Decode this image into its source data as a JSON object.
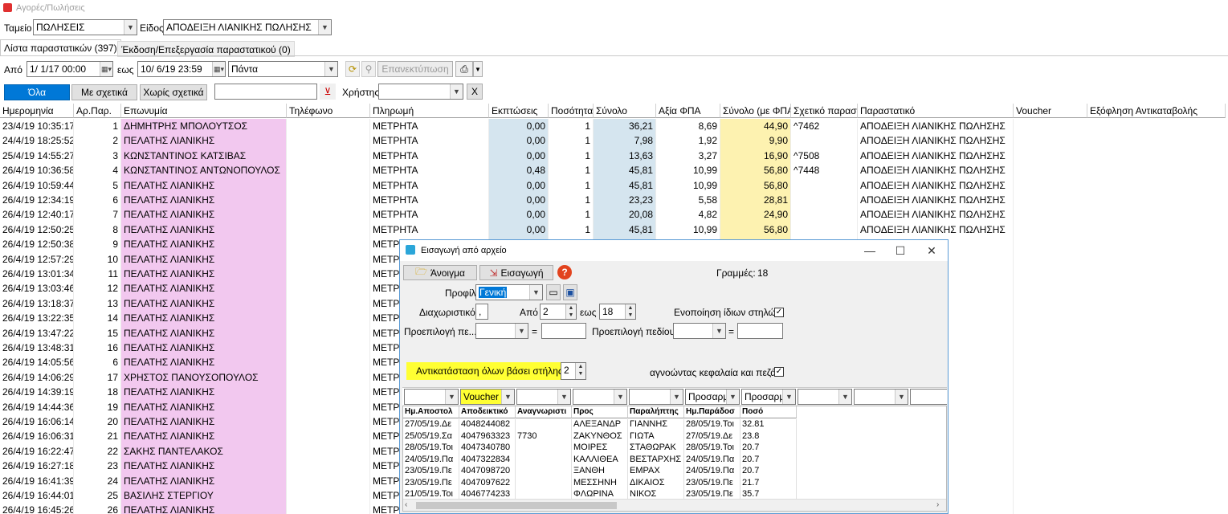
{
  "window": {
    "title": "Αγορές/Πωλήσεις"
  },
  "filters": {
    "tameio_label": "Ταμείο",
    "tameio_value": "ΠΩΛΗΣΕΙΣ",
    "eidos_label": "Είδος",
    "eidos_value": "ΑΠΟΔΕΙΞΗ ΛΙΑΝΙΚΗΣ ΠΩΛΗΣΗΣ",
    "apo_label": "Από",
    "apo_value": "1/ 1/17 00:00",
    "eos_label": "εως",
    "eos_value": "10/ 6/19 23:59",
    "period_value": "Πάντα",
    "reprint_label": "Επανεκτύπωση",
    "xristis_label": "Χρήστης",
    "clear_label": "X"
  },
  "tabs": [
    "Λίστα παραστατικών (397)",
    "Έκδοση/Επεξεργασία παραστατικού (0)"
  ],
  "segment": [
    "Όλα",
    "Με σχετικά",
    "Χωρίς σχετικά"
  ],
  "grid": {
    "headers": [
      "Ημερομηνία",
      "Αρ.Παρ.",
      "Επωνυμία",
      "Τηλέφωνο",
      "Πληρωμή",
      "Εκπτώσεις",
      "Ποσότητα",
      "Σύνολο",
      "Αξία ΦΠΑ",
      "Σύνολο (με ΦΠΑ)",
      "Σχετικό παραστ",
      "Παραστατικό",
      "Voucher",
      "Εξόφληση Αντικαταβολής"
    ],
    "rows": [
      [
        "23/4/19 10:35:17",
        "1",
        "ΔΗΜΗΤΡΗΣ ΜΠΟΛΟΥΤΣΟΣ",
        "",
        "ΜΕΤΡΗΤΑ",
        "0,00",
        "1",
        "36,21",
        "8,69",
        "44,90",
        "^7462",
        "ΑΠΟΔΕΙΞΗ ΛΙΑΝΙΚΗΣ ΠΩΛΗΣΗΣ"
      ],
      [
        "24/4/19 18:25:52",
        "2",
        "ΠΕΛΑΤΗΣ ΛΙΑΝΙΚΗΣ",
        "",
        "ΜΕΤΡΗΤΑ",
        "0,00",
        "1",
        "7,98",
        "1,92",
        "9,90",
        "",
        "ΑΠΟΔΕΙΞΗ ΛΙΑΝΙΚΗΣ ΠΩΛΗΣΗΣ"
      ],
      [
        "25/4/19 14:55:27",
        "3",
        "ΚΩΝΣΤΑΝΤΙΝΟΣ ΚΑΤΣΙΒΑΣ",
        "",
        "ΜΕΤΡΗΤΑ",
        "0,00",
        "1",
        "13,63",
        "3,27",
        "16,90",
        "^7508",
        "ΑΠΟΔΕΙΞΗ ΛΙΑΝΙΚΗΣ ΠΩΛΗΣΗΣ"
      ],
      [
        "26/4/19 10:36:58",
        "4",
        "ΚΩΝΣΤΑΝΤΙΝΟΣ ΑΝΤΩΝΟΠΟΥΛΟΣ",
        "",
        "ΜΕΤΡΗΤΑ",
        "0,48",
        "1",
        "45,81",
        "10,99",
        "56,80",
        "^7448",
        "ΑΠΟΔΕΙΞΗ ΛΙΑΝΙΚΗΣ ΠΩΛΗΣΗΣ"
      ],
      [
        "26/4/19 10:59:44",
        "5",
        "ΠΕΛΑΤΗΣ ΛΙΑΝΙΚΗΣ",
        "",
        "ΜΕΤΡΗΤΑ",
        "0,00",
        "1",
        "45,81",
        "10,99",
        "56,80",
        "",
        "ΑΠΟΔΕΙΞΗ ΛΙΑΝΙΚΗΣ ΠΩΛΗΣΗΣ"
      ],
      [
        "26/4/19 12:34:19",
        "6",
        "ΠΕΛΑΤΗΣ ΛΙΑΝΙΚΗΣ",
        "",
        "ΜΕΤΡΗΤΑ",
        "0,00",
        "1",
        "23,23",
        "5,58",
        "28,81",
        "",
        "ΑΠΟΔΕΙΞΗ ΛΙΑΝΙΚΗΣ ΠΩΛΗΣΗΣ"
      ],
      [
        "26/4/19 12:40:17",
        "7",
        "ΠΕΛΑΤΗΣ ΛΙΑΝΙΚΗΣ",
        "",
        "ΜΕΤΡΗΤΑ",
        "0,00",
        "1",
        "20,08",
        "4,82",
        "24,90",
        "",
        "ΑΠΟΔΕΙΞΗ ΛΙΑΝΙΚΗΣ ΠΩΛΗΣΗΣ"
      ],
      [
        "26/4/19 12:50:25",
        "8",
        "ΠΕΛΑΤΗΣ ΛΙΑΝΙΚΗΣ",
        "",
        "ΜΕΤΡΗΤΑ",
        "0,00",
        "1",
        "45,81",
        "10,99",
        "56,80",
        "",
        "ΑΠΟΔΕΙΞΗ ΛΙΑΝΙΚΗΣ ΠΩΛΗΣΗΣ"
      ],
      [
        "26/4/19 12:50:38",
        "9",
        "ΠΕΛΑΤΗΣ ΛΙΑΝΙΚΗΣ",
        "",
        "ΜΕΤΡ",
        "",
        "",
        "",
        "",
        "",
        "",
        "Σ ΠΩΛΗΣΗΣ"
      ],
      [
        "26/4/19 12:57:29",
        "10",
        "ΠΕΛΑΤΗΣ ΛΙΑΝΙΚΗΣ",
        "",
        "ΜΕΤΡ",
        "",
        "",
        "",
        "",
        "",
        "",
        "Σ ΠΩΛΗΣΗΣ"
      ],
      [
        "26/4/19 13:01:34",
        "11",
        "ΠΕΛΑΤΗΣ ΛΙΑΝΙΚΗΣ",
        "",
        "ΜΕΤΡ",
        "",
        "",
        "",
        "",
        "",
        "",
        "Σ ΠΩΛΗΣΗΣ"
      ],
      [
        "26/4/19 13:03:46",
        "12",
        "ΠΕΛΑΤΗΣ ΛΙΑΝΙΚΗΣ",
        "",
        "ΜΕΤΡ",
        "",
        "",
        "",
        "",
        "",
        "",
        "Σ ΠΩΛΗΣΗΣ"
      ],
      [
        "26/4/19 13:18:37",
        "13",
        "ΠΕΛΑΤΗΣ ΛΙΑΝΙΚΗΣ",
        "",
        "ΜΕΤΡ",
        "",
        "",
        "",
        "",
        "",
        "",
        "Σ ΠΩΛΗΣΗΣ"
      ],
      [
        "26/4/19 13:22:35",
        "14",
        "ΠΕΛΑΤΗΣ ΛΙΑΝΙΚΗΣ",
        "",
        "ΜΕΤΡ",
        "",
        "",
        "",
        "",
        "",
        "",
        "Σ ΠΩΛΗΣΗΣ"
      ],
      [
        "26/4/19 13:47:22",
        "15",
        "ΠΕΛΑΤΗΣ ΛΙΑΝΙΚΗΣ",
        "",
        "ΜΕΤΡ",
        "",
        "",
        "",
        "",
        "",
        "",
        "Σ ΠΩΛΗΣΗΣ"
      ],
      [
        "26/4/19 13:48:31",
        "16",
        "ΠΕΛΑΤΗΣ ΛΙΑΝΙΚΗΣ",
        "",
        "ΜΕΤΡ",
        "",
        "",
        "",
        "",
        "",
        "",
        "Σ ΠΩΛΗΣΗΣ"
      ],
      [
        "26/4/19 14:05:56",
        "6",
        "ΠΕΛΑΤΗΣ ΛΙΑΝΙΚΗΣ",
        "",
        "ΜΕΤΡ",
        "",
        "",
        "",
        "",
        "",
        "",
        "Σ ΠΩΛΗΣΗΣ"
      ],
      [
        "26/4/19 14:06:29",
        "17",
        "ΧΡΗΣΤΟΣ ΠΑΝΟΥΣΟΠΟΥΛΟΣ",
        "",
        "ΜΕΤΡ",
        "",
        "",
        "",
        "",
        "",
        "",
        "Σ ΠΩΛΗΣΗΣ"
      ],
      [
        "26/4/19 14:39:19",
        "18",
        "ΠΕΛΑΤΗΣ ΛΙΑΝΙΚΗΣ",
        "",
        "ΜΕΤΡ",
        "",
        "",
        "",
        "",
        "",
        "",
        "Σ ΠΩΛΗΣΗΣ"
      ],
      [
        "26/4/19 14:44:36",
        "19",
        "ΠΕΛΑΤΗΣ ΛΙΑΝΙΚΗΣ",
        "",
        "ΜΕΤΡ",
        "",
        "",
        "",
        "",
        "",
        "",
        "Σ ΠΩΛΗΣΗΣ"
      ],
      [
        "26/4/19 16:06:14",
        "20",
        "ΠΕΛΑΤΗΣ ΛΙΑΝΙΚΗΣ",
        "",
        "ΜΕΤΡ",
        "",
        "",
        "",
        "",
        "",
        "",
        "Σ ΠΩΛΗΣΗΣ"
      ],
      [
        "26/4/19 16:06:31",
        "21",
        "ΠΕΛΑΤΗΣ ΛΙΑΝΙΚΗΣ",
        "",
        "ΜΕΤΡ",
        "",
        "",
        "",
        "",
        "",
        "",
        "Σ ΠΩΛΗΣΗΣ"
      ],
      [
        "26/4/19 16:22:47",
        "22",
        "ΣΑΚΗΣ ΠΑΝΤΕΛΑΚΟΣ",
        "",
        "ΜΕΤΡ",
        "",
        "",
        "",
        "",
        "",
        "",
        "Σ ΠΩΛΗΣΗΣ"
      ],
      [
        "26/4/19 16:27:18",
        "23",
        "ΠΕΛΑΤΗΣ ΛΙΑΝΙΚΗΣ",
        "",
        "ΜΕΤΡ",
        "",
        "",
        "",
        "",
        "",
        "",
        "Σ ΠΩΛΗΣΗΣ"
      ],
      [
        "26/4/19 16:41:39",
        "24",
        "ΠΕΛΑΤΗΣ ΛΙΑΝΙΚΗΣ",
        "",
        "ΜΕΤΡ",
        "",
        "",
        "",
        "",
        "",
        "",
        "Σ ΠΩΛΗΣΗΣ"
      ],
      [
        "26/4/19 16:44:01",
        "25",
        "ΒΑΣΙΛΗΣ ΣΤΕΡΓΙΟΥ",
        "",
        "ΜΕΤΡ",
        "",
        "",
        "",
        "",
        "",
        "",
        "Σ ΠΩΛΗΣΗΣ"
      ],
      [
        "26/4/19 16:45:26",
        "26",
        "ΠΕΛΑΤΗΣ ΛΙΑΝΙΚΗΣ",
        "",
        "ΜΕΤΡ",
        "",
        "",
        "",
        "",
        "",
        "",
        "Σ ΠΩΛΗΣΗΣ"
      ]
    ]
  },
  "dialog": {
    "title": "Εισαγωγή από αρχείο",
    "open_label": "Άνοιγμα",
    "import_label": "Εισαγωγή",
    "help_glyph": "?",
    "lines_label": "Γραμμές:",
    "lines_value": "18",
    "profile_label": "Προφίλ",
    "profile_value": "Γενική",
    "separator_label": "Διαχωριστικό",
    "separator_value": ",",
    "from_label": "Από",
    "from_value": "2",
    "to_label": "εως",
    "to_value": "18",
    "merge_label": "Ενοποίηση ίδιων στηλών",
    "preselect1_label": "Προεπιλογή πε...",
    "preselect2_label": "Προεπιλογή πεδίου",
    "eq": "=",
    "replace_label": "Αντικατάσταση όλων βάσει στήλης",
    "replace_value": "2",
    "ignore_label": "αγνοώντας κεφαλαία και πεζά",
    "mapping": [
      "",
      "Voucher",
      "",
      "",
      "",
      "Προσαρμ",
      "Προσαρμ",
      "",
      "",
      ""
    ],
    "table_headers": [
      "Ημ.Αποστολ",
      "Αποδεικτικό",
      "Αναγνωριστι",
      "Προς",
      "Παραλήπτης",
      "Ημ.Παράδοσ",
      "Ποσό"
    ],
    "table_rows": [
      [
        "27/05/19.Δε",
        "4048244082",
        "",
        "ΑΛΕΞΑΝΔΡ",
        "ΓΙΑΝΝΗΣ",
        "28/05/19.Τοι",
        "32.81"
      ],
      [
        "25/05/19.Σα",
        "4047963323",
        "7730",
        "ΖΑΚΥΝΘΟΣ",
        "ΓΙΩΤΑ",
        "27/05/19.Δε",
        "23.8"
      ],
      [
        "28/05/19.Τοι",
        "4047340780",
        "",
        "ΜΟΙΡΕΣ",
        "ΣΤΑΘΩΡΑΚ",
        "28/05/19.Τοι",
        "20.7"
      ],
      [
        "24/05/19.Πα",
        "4047322834",
        "",
        "ΚΑΛΛΙΘΕΑ",
        "ΒΕΣΤΑΡΧΗΣ",
        "24/05/19.Πα",
        "20.7"
      ],
      [
        "23/05/19.Πε",
        "4047098720",
        "",
        "ΞΑΝΘΗ",
        "ΕΜΡΑΧ",
        "24/05/19.Πα",
        "20.7"
      ],
      [
        "23/05/19.Πε",
        "4047097622",
        "",
        "ΜΕΣΣΗΝΗ",
        "ΔΙΚΑΙΟΣ",
        "23/05/19.Πε",
        "21.7"
      ],
      [
        "21/05/19.Τοι",
        "4046774233",
        "",
        "ΦΛΩΡΙΝΑ",
        "ΝΙΚΟΣ",
        "23/05/19.Πε",
        "35.7"
      ]
    ]
  },
  "colors": {
    "pink": "#f2c8ef",
    "blue": "#d5e5ef",
    "yellow": "#fdf2b0",
    "accent": "#0078d7",
    "highlight": "#ffff33"
  }
}
